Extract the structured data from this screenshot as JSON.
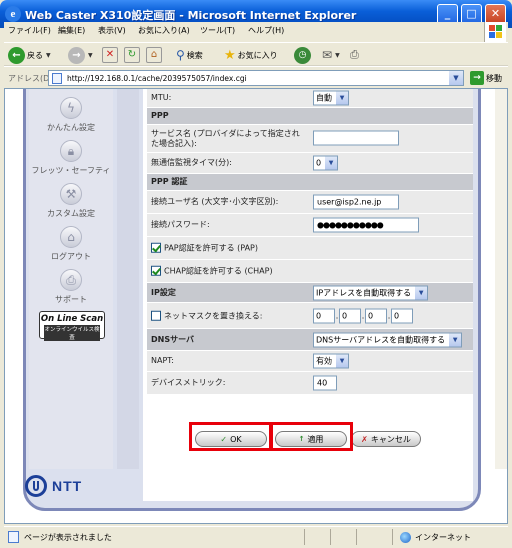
{
  "window": {
    "title": "Web Caster X310設定画面 - Microsoft Internet Explorer",
    "minimize": "_",
    "maximize": "□",
    "close": "✕"
  },
  "menu": [
    "ファイル(F)",
    "編集(E)",
    "表示(V)",
    "お気に入り(A)",
    "ツール(T)",
    "ヘルプ(H)"
  ],
  "toolbar": {
    "back": "戻る",
    "search": "検索",
    "favorites": "お気に入り"
  },
  "address": {
    "label": "アドレス(D)",
    "url": "http://192.168.0.1/cache/2039575057/index.cgi",
    "go": "移動"
  },
  "sidebar": {
    "items": [
      {
        "label": "かんたん設定",
        "icon": "lightning-icon"
      },
      {
        "label": "フレッツ・セーフティ",
        "icon": "lock-icon"
      },
      {
        "label": "カスタム設定",
        "icon": "tools-icon"
      },
      {
        "label": "ログアウト",
        "icon": "house-icon"
      },
      {
        "label": "サポート",
        "icon": "printer-icon"
      }
    ],
    "online_scan": {
      "title": "On Line Scan",
      "subtitle": "オンラインウイルス検査"
    },
    "brand": "NTT"
  },
  "form": {
    "mtu": {
      "label": "MTU:",
      "value": "自動"
    },
    "ppp_header": "PPP",
    "service_name": {
      "label": "サービス名 (プロバイダによって指定された場合記入):",
      "value": ""
    },
    "idle_timer": {
      "label": "無通信監視タイマ(分):",
      "value": "0"
    },
    "ppp_auth_header": "PPP 認証",
    "username": {
      "label": "接続ユーザ名 (大文字･小文字区別):",
      "value": "user@isp2.ne.jp"
    },
    "password": {
      "label": "接続パスワード:",
      "value": "●●●●●●●●●●●"
    },
    "pap": {
      "label": "PAP認証を許可する (PAP)",
      "checked": true
    },
    "chap": {
      "label": "CHAP認証を許可する (CHAP)",
      "checked": true
    },
    "ip_header": "IP設定",
    "ip_mode": "IPアドレスを自動取得する",
    "netmask": {
      "label": "ネットマスクを置き換える:",
      "checked": false,
      "octets": [
        "0",
        "0",
        "0",
        "0"
      ]
    },
    "dns_header": "DNSサーバ",
    "dns_mode": "DNSサーバアドレスを自動取得する",
    "napt": {
      "label": "NAPT:",
      "value": "有効"
    },
    "metric": {
      "label": "デバイスメトリック:",
      "value": "40"
    }
  },
  "buttons": {
    "ok": "OK",
    "apply": "適用",
    "cancel": "キャンセル"
  },
  "status": {
    "text": "ページが表示されました",
    "zone": "インターネット"
  },
  "colors": {
    "section_bg": "#c7c9cf",
    "row_bg": "#eaeaea",
    "highlight": "#e8000a",
    "title_bar": "#0a5fd8"
  }
}
